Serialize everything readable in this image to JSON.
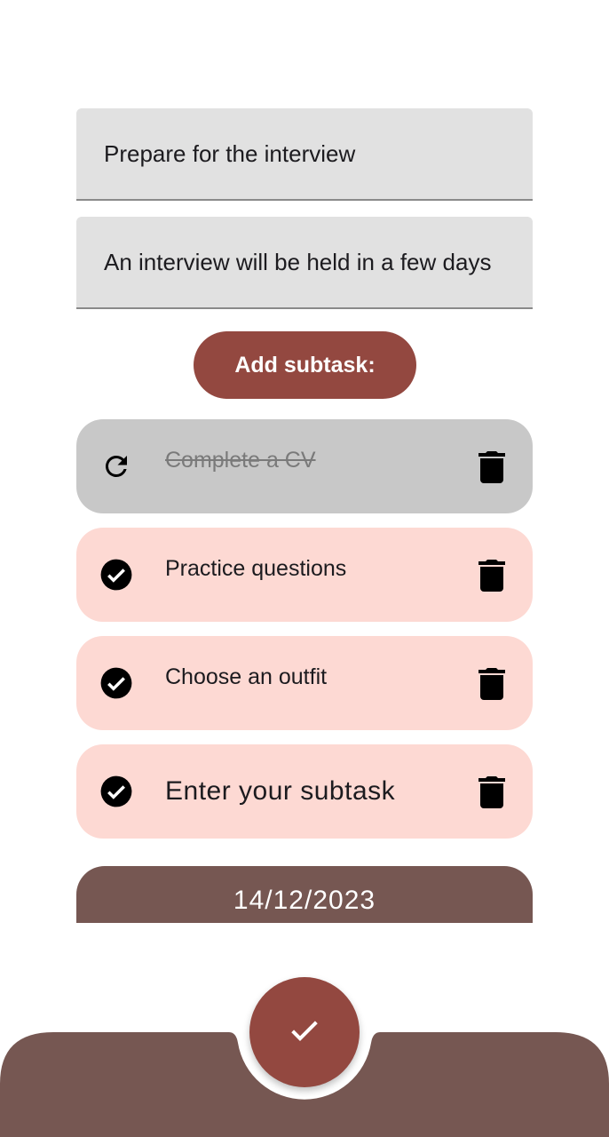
{
  "task": {
    "title_value": "Prepare for the interview",
    "description_value": "An interview will be held in a few days"
  },
  "add_subtask_label": "Add subtask:",
  "subtasks": [
    {
      "text": "Complete a CV",
      "completed": true,
      "lead_icon": "refresh-icon",
      "trash_icon": "trash-icon"
    },
    {
      "text": "Practice questions",
      "completed": false,
      "lead_icon": "check-circle-icon",
      "trash_icon": "trash-icon"
    },
    {
      "text": "Choose an outfit",
      "completed": false,
      "lead_icon": "check-circle-icon",
      "trash_icon": "trash-icon"
    },
    {
      "text": "",
      "placeholder": "Enter your subtask",
      "completed": false,
      "lead_icon": "check-circle-icon",
      "trash_icon": "trash-icon"
    }
  ],
  "due_date": "14/12/2023",
  "fab": {
    "icon": "check-icon"
  },
  "colors": {
    "accent": "#934840",
    "bottom_bar": "#765752",
    "subtask_active_bg": "#fdd9d3",
    "subtask_done_bg": "#c8c8c8",
    "field_bg": "#e1e1e1"
  }
}
